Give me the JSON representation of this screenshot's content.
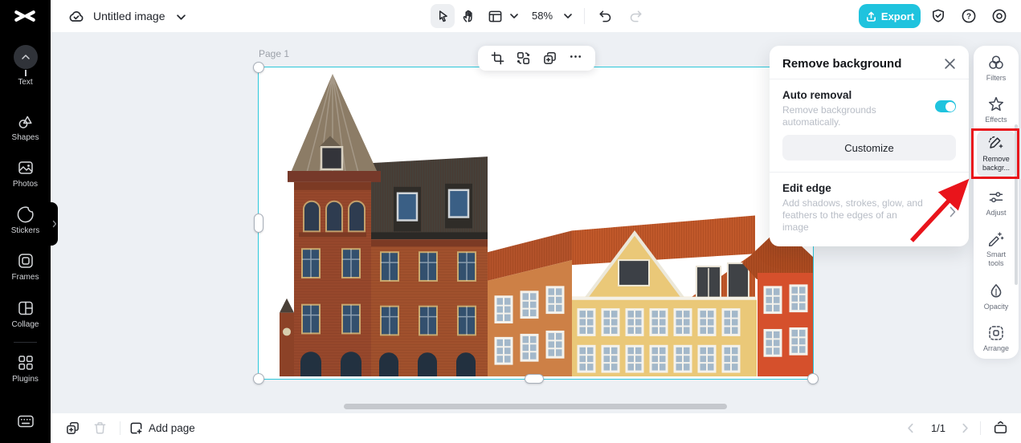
{
  "top_bar": {
    "title": "Untitled image",
    "zoom_value": "58%",
    "export_label": "Export"
  },
  "left_sidebar": {
    "items": [
      {
        "label": "Text"
      },
      {
        "label": "Shapes"
      },
      {
        "label": "Photos"
      },
      {
        "label": "Stickers"
      },
      {
        "label": "Frames"
      },
      {
        "label": "Collage"
      },
      {
        "label": "Plugins"
      }
    ]
  },
  "canvas": {
    "page_label": "Page 1"
  },
  "panel": {
    "title": "Remove background",
    "auto_removal_label": "Auto removal",
    "auto_removal_desc": "Remove backgrounds automatically.",
    "auto_removal_on": true,
    "customize_label": "Customize",
    "edit_edge_label": "Edit edge",
    "edit_edge_desc": "Add shadows, strokes, glow, and feathers to the edges of an image"
  },
  "right_rail": {
    "items": [
      {
        "label": "Filters"
      },
      {
        "label": "Effects"
      },
      {
        "label": "Remove backgr..."
      },
      {
        "label": "Adjust"
      },
      {
        "label": "Smart tools"
      },
      {
        "label": "Opacity"
      },
      {
        "label": "Arrange"
      }
    ],
    "selected": "Remove backgr..."
  },
  "bottom_bar": {
    "add_page_label": "Add page",
    "page_indicator": "1/1"
  },
  "icons": {
    "help_glyph": "?"
  },
  "colors": {
    "accent": "#1fc3de",
    "selection": "#2cc7da",
    "annotation_red": "#e9141b",
    "sidebar_bg": "#000000"
  }
}
